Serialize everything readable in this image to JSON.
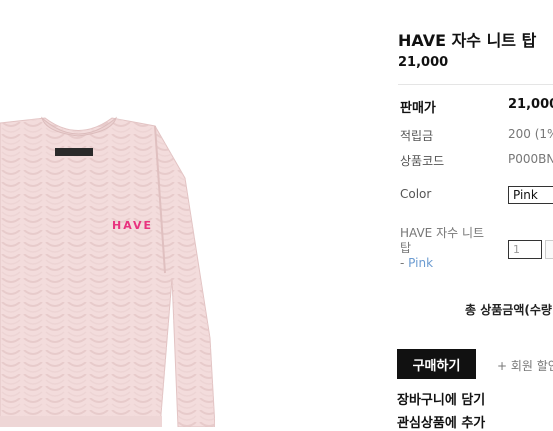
{
  "product": {
    "title": "HAVE 자수 니트 탑",
    "price": "21,000",
    "image_embroidery": "HAVE"
  },
  "details": {
    "sale_price_label": "판매가",
    "sale_price_value": "21,000",
    "points_label": "적립금",
    "points_value": "200 (1%",
    "code_label": "상품코드",
    "code_value": "P000BN"
  },
  "options": {
    "color_label": "Color",
    "color_selected": "Pink",
    "selected_item_name": "HAVE 자수 니트 탑",
    "selected_item_color_prefix": "- ",
    "selected_item_color": "Pink",
    "quantity": "1"
  },
  "summary": {
    "total_label": "총 상품금액(수량"
  },
  "actions": {
    "buy_label": "구매하기",
    "member_discount_label": "+ 회원 할인",
    "add_to_cart_label": "장바구니에 담기",
    "add_to_wishlist_label": "관심상품에 추가"
  },
  "colors": {
    "sweater": "#f3dcdc",
    "embroidery": "#e8337f",
    "link_color": "#6b9bd1",
    "button_bg": "#111111"
  }
}
